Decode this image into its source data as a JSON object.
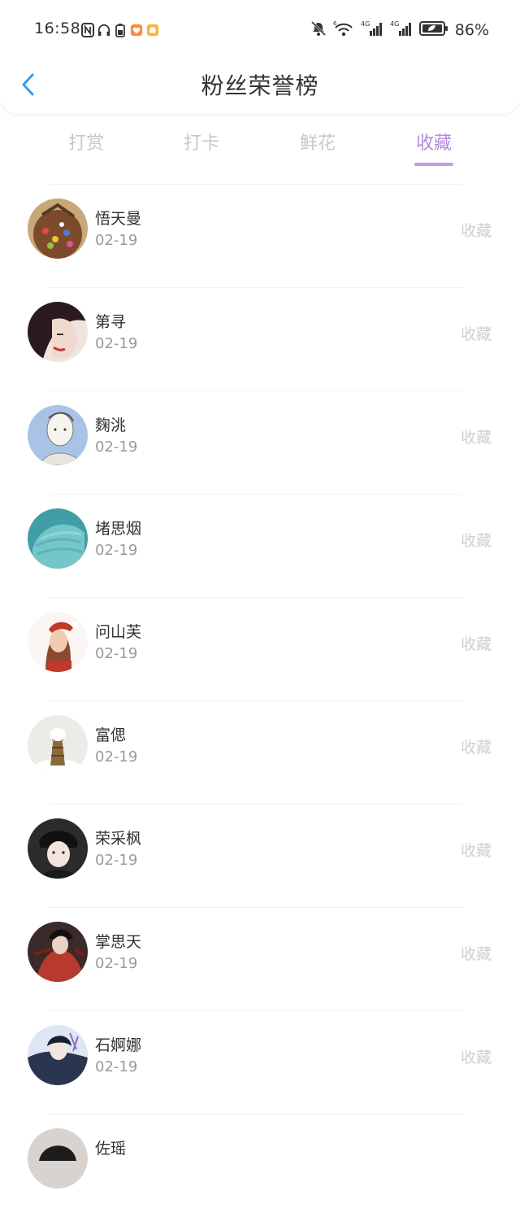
{
  "status_bar": {
    "time": "16:58",
    "battery": "86%",
    "left_icons": [
      "nfc-icon",
      "headphones-icon",
      "battery-saver-icon",
      "app-heart-icon",
      "app-pot-icon"
    ],
    "right_icons": [
      "mute-bell-icon",
      "wifi-icon",
      "signal-4g-icon",
      "signal-4g-icon-2",
      "battery-icon"
    ]
  },
  "header": {
    "title": "粉丝荣誉榜",
    "back_icon": "chevron-left-icon"
  },
  "tabs": [
    {
      "label": "打赏",
      "active": false
    },
    {
      "label": "打卡",
      "active": false
    },
    {
      "label": "鲜花",
      "active": false
    },
    {
      "label": "收藏",
      "active": true
    }
  ],
  "accent_color": "#b48ad8",
  "fans": [
    {
      "name": "悟天曼",
      "date": "02-19",
      "action": "收藏"
    },
    {
      "name": "第寻",
      "date": "02-19",
      "action": "收藏"
    },
    {
      "name": "麴洮",
      "date": "02-19",
      "action": "收藏"
    },
    {
      "name": "堵思烟",
      "date": "02-19",
      "action": "收藏"
    },
    {
      "name": "问山芙",
      "date": "02-19",
      "action": "收藏"
    },
    {
      "name": "富偲",
      "date": "02-19",
      "action": "收藏"
    },
    {
      "name": "荣采枫",
      "date": "02-19",
      "action": "收藏"
    },
    {
      "name": "掌思天",
      "date": "02-19",
      "action": "收藏"
    },
    {
      "name": "石婀娜",
      "date": "02-19",
      "action": "收藏"
    },
    {
      "name": "佐瑶",
      "date": "",
      "action": ""
    }
  ]
}
